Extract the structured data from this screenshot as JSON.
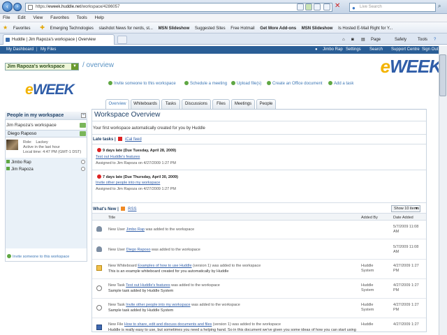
{
  "browser": {
    "url_host": "https://",
    "url_mid": "eweek.huddle.net",
    "url_path": "/workspace/4286057",
    "search_placeholder": "Live Search",
    "menu": [
      "File",
      "Edit",
      "View",
      "Favorites",
      "Tools",
      "Help"
    ],
    "favorites_label": "Favorites",
    "favorites": [
      "Emerging Technologies",
      "slashdot News for nerds, st...",
      "MSN Slideshow",
      "Suggested Sites",
      "Free Hotmail",
      "Get More Add-ons",
      "MSN Slideshow",
      "Is Hosted E-Mail Right for Y..."
    ],
    "tab_title": "Huddle | Jim Rapoza's workspace | Overview",
    "tools": [
      "Page",
      "Safety",
      "Tools"
    ]
  },
  "huddle_nav": {
    "my_dashboard": "My Dashboard",
    "my_files": "My Files",
    "user": "Jimbo Rap",
    "settings": "Settings",
    "search": "Search",
    "support": "Support Centre",
    "sign_out": "Sign Out"
  },
  "workspace": {
    "select_value": "Jim Rapoza's workspace",
    "page_title": "/ overview"
  },
  "brand": {
    "logo_e": "e",
    "logo_rest": "WEEK"
  },
  "quick_actions": [
    "Invite someone to this workspace",
    "Schedule a meeting",
    "Upload file(s)",
    "Create an Office document",
    "Add a task"
  ],
  "tabs": [
    "Overview",
    "Whiteboards",
    "Tasks",
    "Discussions",
    "Files",
    "Meetings",
    "People"
  ],
  "sidebar": {
    "title": "People in my workspace",
    "workspace_name": "Jim Rapoza's workspace",
    "selected_person": "Diego Raposo",
    "role_label": "Role:",
    "role_value": "Lackey",
    "status": "Active in the last hour",
    "local_time_label": "Local time:",
    "local_time_value": "4:47 PM (GMT-1 DST)",
    "members": [
      "Jimbo Rap",
      "Jim Rapoza"
    ],
    "invite": "Invite someone to this workspace"
  },
  "overview": {
    "title": "Workspace Overview",
    "description": "Your first workspace automatically created for you by Huddle",
    "late_tasks_label": "Late tasks |",
    "ical": "iCal feed",
    "late_tasks": [
      {
        "late": "9 days late (Due Tuesday, April 28, 2009)",
        "task": "Test out Huddle's features",
        "assigned": "Assigned to Jim Rapoza on 4/27/2009 1:27 PM"
      },
      {
        "late": "7 days late (Due Thursday, April 30, 2009)",
        "task": "Invite other people into my workspace",
        "assigned": "Assigned to Jim Rapoza on 4/27/2009 1:27 PM"
      }
    ],
    "whats_new_label": "What's New |",
    "rss": "RSS",
    "show_button": "Show 10 items",
    "columns": {
      "title": "Title",
      "added_by": "Added By",
      "date_added": "Date Added"
    },
    "items": [
      {
        "icon": "user-icon",
        "pre": "New User ",
        "link": "Jimbo Rap",
        "post": " was added to the workspace",
        "sub": "",
        "by": "",
        "date": "5/7/2009 11:08 AM"
      },
      {
        "icon": "user-icon",
        "pre": "New User ",
        "link": "Diego Raposo",
        "post": " was added to the workspace",
        "sub": "",
        "by": "",
        "date": "5/7/2009 11:08 AM"
      },
      {
        "icon": "whiteboard-icon",
        "pre": "New Whiteboard ",
        "link": "Examples of how to use Huddle",
        "post": " (version 1) was added to the workspace",
        "sub": "This is an example whiteboard created for you automatically by Huddle",
        "by": "Huddle System",
        "date": "4/27/2009 1:27 PM"
      },
      {
        "icon": "task-icon",
        "pre": "New Task ",
        "link": "Test out Huddle's features",
        "post": " was added to the workspace",
        "sub": "Sample task added by Huddle System",
        "by": "Huddle System",
        "date": "4/27/2009 1:27 PM"
      },
      {
        "icon": "task-icon",
        "pre": "New Task ",
        "link": "Invite other people into my workspace",
        "post": " was added to the workspace",
        "sub": "Sample task added by Huddle System",
        "by": "Huddle System",
        "date": "4/27/2009 1:27 PM"
      },
      {
        "icon": "file-icon",
        "pre": "New File ",
        "link": "How to share, edit and discuss documents and files",
        "post": " (version 1) was added to the workspace",
        "sub": "Huddle is really easy to use, but sometimes you need a helping hand. So in this document we've given you some ideas of how you can start using",
        "by": "Huddle",
        "date": "4/27/2009 1:27"
      }
    ]
  },
  "colors": {
    "nav_blue": "#2a5e96",
    "link_blue": "#2f5da8",
    "brand_yellow": "#f3b300",
    "late_red": "#dd2222",
    "action_green": "#5fa743"
  }
}
